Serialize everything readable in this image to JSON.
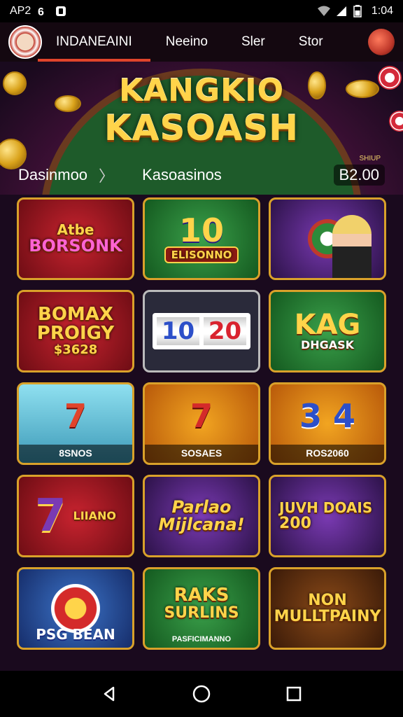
{
  "status_bar": {
    "left_text": "AP2",
    "time": "1:04"
  },
  "top_nav": {
    "tabs": [
      "INDANEAINI",
      "Neeino",
      "Sler",
      "Stor"
    ],
    "active_index": 0
  },
  "hero": {
    "logo_line1": "KANGKIO",
    "logo_line2": "KASOASH"
  },
  "subnav": {
    "left": "Dasinmoo",
    "middle": "Kasoasinos",
    "balance_label": "SHIUP",
    "balance_value": "B2.00"
  },
  "tiles": [
    {
      "style": "red",
      "line1": "Atbe",
      "line2": "BORSONK",
      "footer": ""
    },
    {
      "style": "green",
      "line1": "10",
      "line2": "ELISONNO",
      "footer": ""
    },
    {
      "style": "purple",
      "line1": "",
      "line2": "",
      "footer": ""
    },
    {
      "style": "red",
      "line1": "BOMAX PROIGY",
      "line2": "$3628",
      "footer": ""
    },
    {
      "style": "reels",
      "line1": "10",
      "line2": "20",
      "footer": ""
    },
    {
      "style": "green",
      "line1": "KAG",
      "line2": "DHGASK",
      "footer": ""
    },
    {
      "style": "teal",
      "line1": "7",
      "line2": "",
      "footer": "8SNOS"
    },
    {
      "style": "orange",
      "line1": "7",
      "line2": "",
      "footer": "SOSAES"
    },
    {
      "style": "orange",
      "line1": "3 4",
      "line2": "",
      "footer": "ROS2060"
    },
    {
      "style": "red",
      "line1": "7",
      "line2": "LIIANO",
      "footer": ""
    },
    {
      "style": "purple",
      "line1": "Parlao Mijlcana!",
      "line2": "",
      "footer": ""
    },
    {
      "style": "purple",
      "line1": "JUVH DOAIS",
      "line2": "200",
      "footer": ""
    },
    {
      "style": "blue",
      "line1": "PSG BEAN",
      "line2": "",
      "footer": ""
    },
    {
      "style": "green",
      "line1": "RAKS",
      "line2": "SURLINS",
      "footer": "PASFICIMANNO"
    },
    {
      "style": "orange",
      "line1": "NON MULLTPAINY",
      "line2": "",
      "footer": ""
    }
  ],
  "colors": {
    "accent_underline": "#e0442b",
    "gold_text": "#ffd44a",
    "tile_border": "#d9a12a"
  },
  "icons": {
    "status": [
      "signal-6-icon",
      "notification-icon",
      "wifi-icon",
      "cell-signal-icon",
      "battery-icon"
    ],
    "nav": [
      "back-icon",
      "home-icon",
      "recents-icon"
    ]
  }
}
